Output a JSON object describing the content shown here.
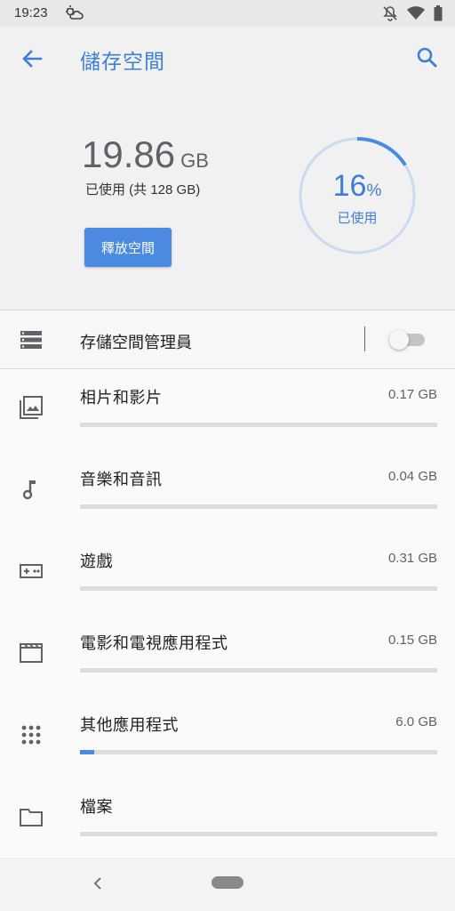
{
  "status": {
    "time": "19:23",
    "icons": [
      "weather-icon",
      "notifications-off-icon",
      "wifi-icon",
      "battery-icon"
    ]
  },
  "header": {
    "title": "儲存空間",
    "used_value": "19.86",
    "used_unit": "GB",
    "used_of": "已使用 (共 128 GB)",
    "free_button": "釋放空間",
    "percent_value": "16",
    "percent_symbol": "%",
    "percent_fraction": 0.16,
    "percent_label": "已使用"
  },
  "manager": {
    "label": "存儲空間管理員",
    "enabled": false
  },
  "categories": [
    {
      "label": "相片和影片",
      "size": "0.17 GB",
      "fraction": 0.0,
      "icon": "photo-icon"
    },
    {
      "label": "音樂和音訊",
      "size": "0.04 GB",
      "fraction": 0.0,
      "icon": "music-note-icon"
    },
    {
      "label": "遊戲",
      "size": "0.31 GB",
      "fraction": 0.0,
      "icon": "gamepad-icon"
    },
    {
      "label": "電影和電視應用程式",
      "size": "0.15 GB",
      "fraction": 0.0,
      "icon": "movie-icon"
    },
    {
      "label": "其他應用程式",
      "size": "6.0 GB",
      "fraction": 0.04,
      "icon": "apps-grid-icon"
    },
    {
      "label": "檔案",
      "size": "",
      "fraction": 0.0,
      "icon": "folder-icon"
    }
  ],
  "colors": {
    "accent": "#4a8ae0",
    "title": "#3d7fd8",
    "ring_track": "#c9daf2"
  }
}
